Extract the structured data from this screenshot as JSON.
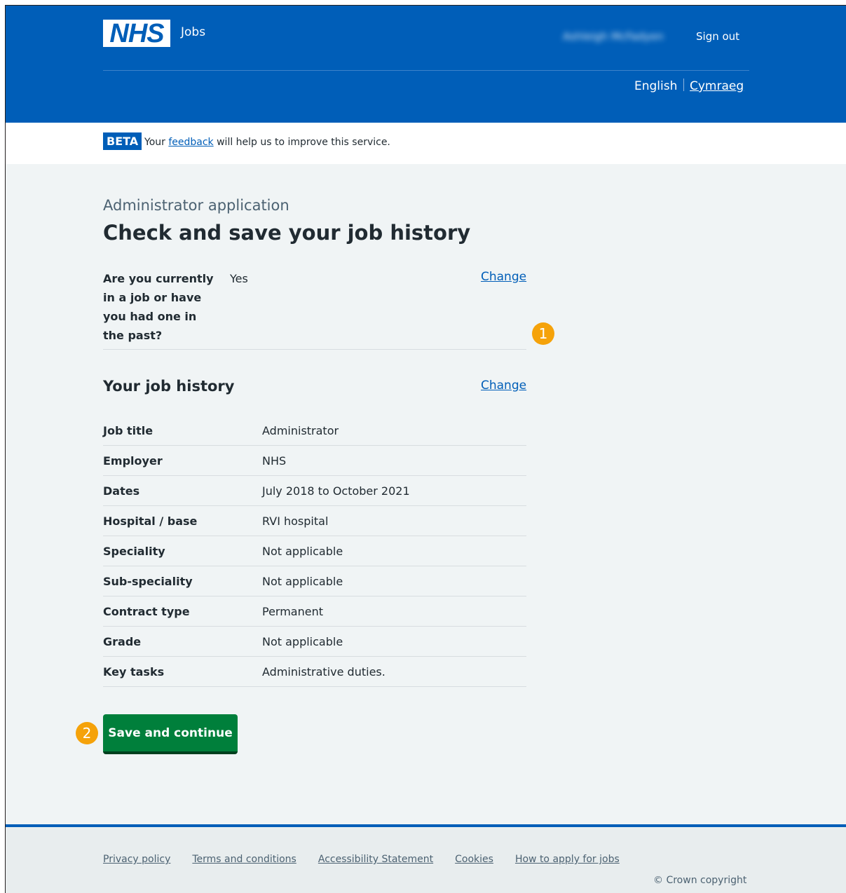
{
  "header": {
    "logo_text": "NHS",
    "service_name": "Jobs",
    "user_name": "Ashleigh McFadyen",
    "sign_out": "Sign out",
    "language": {
      "current": "English",
      "alternate": "Cymraeg"
    }
  },
  "beta_banner": {
    "tag": "BETA",
    "text_before": "Your",
    "link": "feedback",
    "text_after": "will help us to improve this service."
  },
  "main": {
    "caption": "Administrator application",
    "title": "Check and save your job history",
    "question": {
      "label": "Are you currently in a job or have you had one in the past?",
      "value": "Yes",
      "change": "Change"
    },
    "history": {
      "title": "Your job history",
      "change": "Change",
      "rows": [
        {
          "key": "Job title",
          "value": "Administrator"
        },
        {
          "key": "Employer",
          "value": "NHS"
        },
        {
          "key": "Dates",
          "value": "July 2018 to October 2021"
        },
        {
          "key": "Hospital / base",
          "value": "RVI hospital"
        },
        {
          "key": "Speciality",
          "value": "Not applicable"
        },
        {
          "key": "Sub-speciality",
          "value": "Not applicable"
        },
        {
          "key": "Contract type",
          "value": "Permanent"
        },
        {
          "key": "Grade",
          "value": "Not applicable"
        },
        {
          "key": "Key tasks",
          "value": "Administrative duties."
        }
      ]
    },
    "save_button": "Save and continue"
  },
  "callouts": [
    "1",
    "2"
  ],
  "footer": {
    "links": [
      "Privacy policy",
      "Terms and conditions",
      "Accessibility Statement",
      "Cookies",
      "How to apply for jobs"
    ],
    "copyright": "© Crown copyright"
  },
  "colors": {
    "nhs_blue": "#005eb8",
    "button_green": "#007f3b",
    "callout_orange": "#f5a20a",
    "page_grey": "#f0f4f5"
  }
}
